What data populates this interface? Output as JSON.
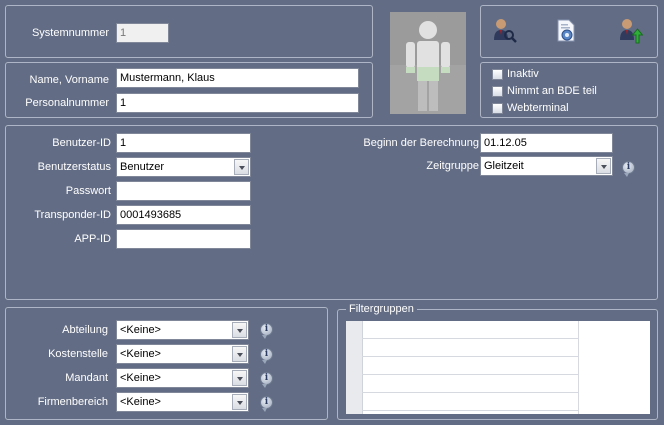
{
  "system": {
    "label": "Systemnummer",
    "value": "1"
  },
  "person": {
    "name_label": "Name, Vorname",
    "name_value": "Mustermann, Klaus",
    "persnr_label": "Personalnummer",
    "persnr_value": "1"
  },
  "toolbar": {
    "icons": [
      "user-search-icon",
      "settings-document-icon",
      "user-upload-icon"
    ]
  },
  "flags": [
    {
      "label": "Inaktiv",
      "checked": false
    },
    {
      "label": "Nimmt an BDE teil",
      "checked": false
    },
    {
      "label": "Webterminal",
      "checked": false
    }
  ],
  "user": {
    "userid_label": "Benutzer-ID",
    "userid_value": "1",
    "status_label": "Benutzerstatus",
    "status_value": "Benutzer",
    "password_label": "Passwort",
    "password_value": "",
    "transponder_label": "Transponder-ID",
    "transponder_value": "0001493685",
    "appid_label": "APP-ID",
    "appid_value": "",
    "begin_label": "Beginn der Berechnung",
    "begin_value": "01.12.05",
    "timegroup_label": "Zeitgruppe",
    "timegroup_value": "Gleitzeit"
  },
  "org": {
    "dept_label": "Abteilung",
    "dept_value": "<Keine>",
    "cost_label": "Kostenstelle",
    "cost_value": "<Keine>",
    "client_label": "Mandant",
    "client_value": "<Keine>",
    "company_label": "Firmenbereich",
    "company_value": "<Keine>"
  },
  "filter": {
    "title": "Filtergruppen"
  }
}
